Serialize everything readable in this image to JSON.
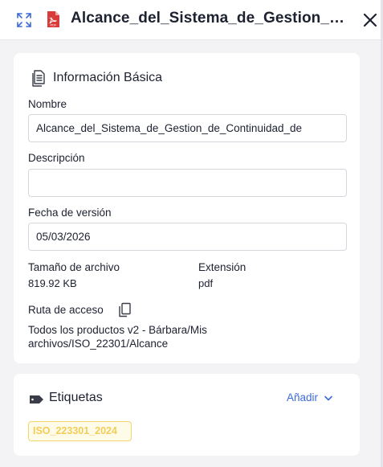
{
  "header": {
    "title": "Alcance_del_Sistema_de_Gestion_de_Continuidad_de",
    "file_type_badge": "PDF"
  },
  "info": {
    "section_title": "Información Básica",
    "name_label": "Nombre",
    "name_value": "Alcance_del_Sistema_de_Gestion_de_Continuidad_de",
    "description_label": "Descripción",
    "description_value": "",
    "version_date_label": "Fecha de versión",
    "version_date_value": "05/03/2026",
    "file_size_label": "Tamaño de archivo",
    "file_size_value": "819.92 KB",
    "extension_label": "Extensión",
    "extension_value": "pdf",
    "path_label": "Ruta de acceso",
    "path_value": "Todos los productos v2 - Bárbara/Mis archivos/ISO_22301/Alcance"
  },
  "tags": {
    "section_title": "Etiquetas",
    "add_label": "Añadir",
    "items": [
      "ISO_223301_2024"
    ]
  },
  "colors": {
    "accent": "#3d6bd6",
    "pdf_red": "#d93a3a",
    "tag_yellow": "#f2cd57"
  },
  "icons": {
    "expand": "expand-icon",
    "file": "pdf-file-icon",
    "close": "close-icon",
    "section": "document-icon",
    "copy": "copy-icon",
    "tag": "tag-icon",
    "add_chevron": "chevron-down-icon"
  }
}
